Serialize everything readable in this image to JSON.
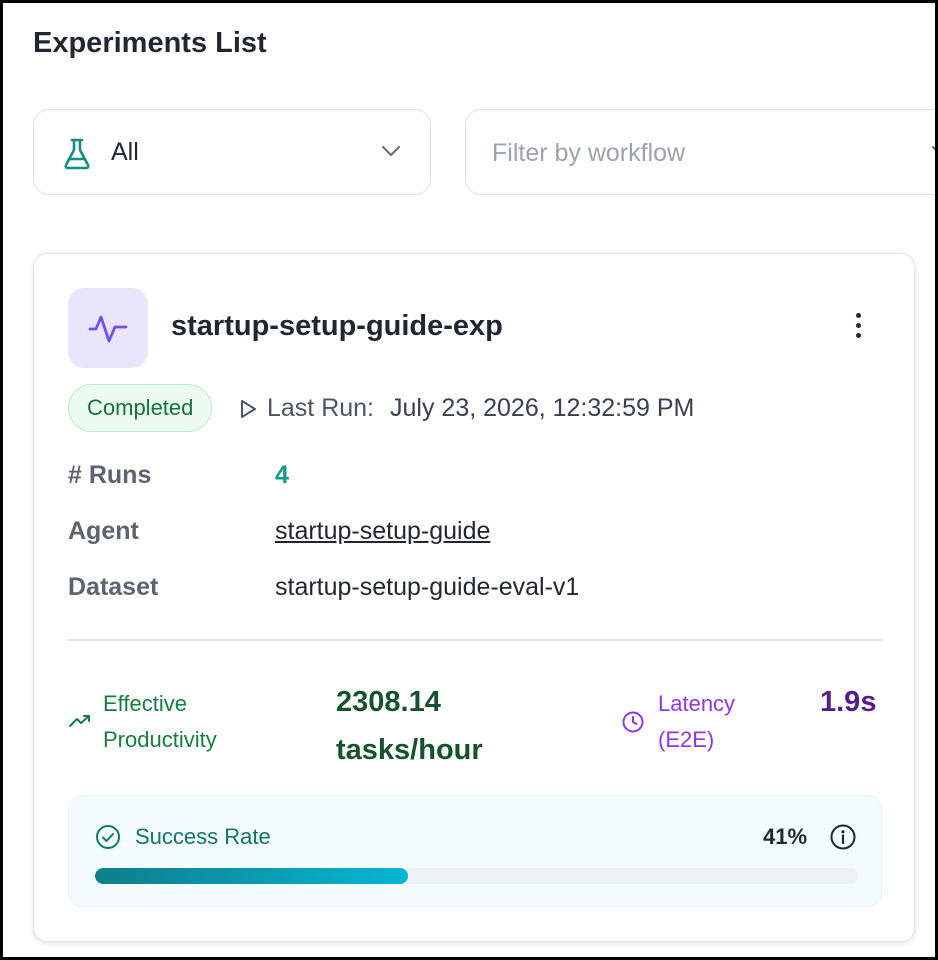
{
  "page": {
    "title": "Experiments List"
  },
  "filters": {
    "type_select": {
      "value": "All",
      "icon": "flask-icon"
    },
    "workflow_filter": {
      "placeholder": "Filter by workflow",
      "value": ""
    }
  },
  "experiment": {
    "name": "startup-setup-guide-exp",
    "icon": "activity-icon",
    "status": "Completed",
    "last_run_label": "Last Run:",
    "last_run_value": "July 23, 2026, 12:32:59 PM",
    "details": {
      "runs_label": "# Runs",
      "runs_value": "4",
      "agent_label": "Agent",
      "agent_value": "startup-setup-guide",
      "dataset_label": "Dataset",
      "dataset_value": "startup-setup-guide-eval-v1"
    },
    "metrics": {
      "productivity_label_line1": "Effective",
      "productivity_label_line2": "Productivity",
      "productivity_value_line1": "2308.14",
      "productivity_value_line2": "tasks/hour",
      "latency_label_line1": "Latency",
      "latency_label_line2": "(E2E)",
      "latency_value": "1.9s"
    },
    "success_rate": {
      "label": "Success Rate",
      "value_text": "41%",
      "fraction": 0.41
    }
  },
  "colors": {
    "accent_teal": "#0f9c8f",
    "status_green": "#16733a",
    "productivity_green": "#14532d",
    "latency_purple": "#581c87",
    "icon_bg_lavender": "#e9e5fd"
  }
}
